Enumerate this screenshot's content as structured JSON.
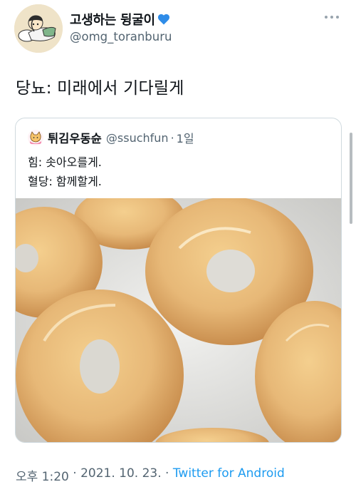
{
  "author": {
    "display_name": "고생하는 뒹굴이",
    "handle": "@omg_toranburu",
    "emoji_icon": "blue-heart-icon",
    "avatar_icon": "lying-character-avatar"
  },
  "tweet": {
    "text": "당뇨: 미래에서 기다릴게"
  },
  "quoted": {
    "display_name": "튀김우동슌",
    "handle": "@ssuchfun",
    "separator": "·",
    "time": "1일",
    "line1": "힘: 솟아오를게.",
    "line2": "혈당: 함께할게.",
    "image_icon": "glazed-donuts-photo"
  },
  "meta": {
    "time": "오후 1:20",
    "sep1": " · ",
    "date": "2021. 10. 23.",
    "sep2": " · ",
    "source": "Twitter for Android"
  },
  "colors": {
    "text": "#0f1419",
    "secondary": "#536471",
    "link": "#1d9bf0",
    "border": "#cfd9de"
  }
}
